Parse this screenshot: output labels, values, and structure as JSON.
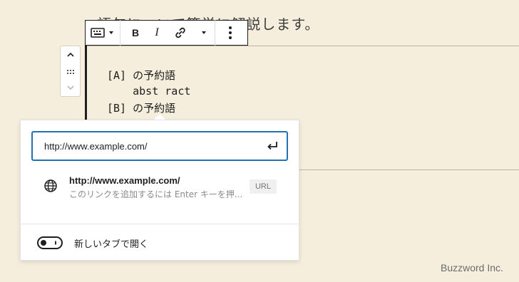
{
  "editor": {
    "heading": "語句について簡単に解説します。",
    "code_lines": [
      "[A] の予約語",
      "    abst ract",
      "[B] の予約語"
    ]
  },
  "toolbar": {
    "bold_label": "B",
    "italic_label": "I"
  },
  "link_popover": {
    "url_value": "http://www.example.com/",
    "suggestion": {
      "title": "http://www.example.com/",
      "description": "このリンクを追加するには Enter キーを押...",
      "type_badge": "URL"
    },
    "new_tab_label": "新しいタブで開く"
  },
  "watermark": "Buzzword Inc.",
  "colors": {
    "background": "#f5eedd",
    "focus_border": "#2271b1"
  }
}
